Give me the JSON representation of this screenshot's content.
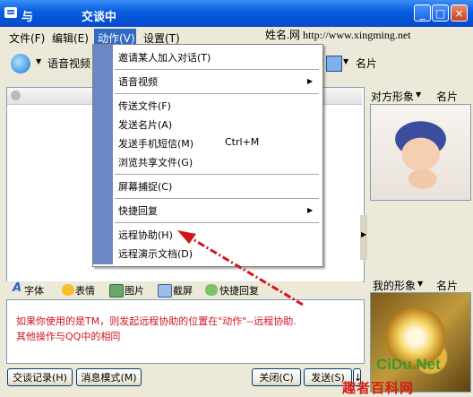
{
  "window": {
    "title_left": "与",
    "title_main": "交谈中",
    "controls": [
      "_",
      "□",
      "×"
    ]
  },
  "menubar": {
    "items": [
      "文件(F)",
      "编辑(E)",
      "动作(V)",
      "设置(T)"
    ],
    "watermark": "姓名.网 http://www.xingming.net"
  },
  "toolbar": {
    "voice_label": "语音视频",
    "card_label": "名片",
    "icon": "voice-video-icon"
  },
  "dropdown": {
    "items": [
      {
        "label": "邀请某人加入对话(T)",
        "shortcut": "",
        "submenu": false
      },
      {
        "label": "语音视频",
        "shortcut": "",
        "submenu": true
      },
      {
        "label": "传送文件(F)",
        "shortcut": "",
        "submenu": false
      },
      {
        "label": "发送名片(A)",
        "shortcut": "",
        "submenu": false
      },
      {
        "label": "发送手机短信(M)",
        "shortcut": "Ctrl+M",
        "submenu": false
      },
      {
        "label": "浏览共享文件(G)",
        "shortcut": "",
        "submenu": false
      },
      {
        "label": "屏幕捕捉(C)",
        "shortcut": "",
        "submenu": false
      },
      {
        "label": "快捷回复",
        "shortcut": "",
        "submenu": true
      },
      {
        "label": "远程协助(H)",
        "shortcut": "",
        "submenu": false
      },
      {
        "label": "远程演示文档(D)",
        "shortcut": "",
        "submenu": false
      }
    ]
  },
  "formatbar": {
    "items": [
      "字体",
      "表情",
      "图片",
      "截屏",
      "快捷回复"
    ]
  },
  "input": {
    "text_line1": "如果你使用的是TM，则发起远程协助的位置在\"动作\"--远程协助.",
    "text_line2": "其他操作与QQ中的相同"
  },
  "buttons": {
    "history": "交谈记录(H)",
    "message_mode": "消息模式(M)",
    "close": "关闭(C)",
    "send": "发送(S)"
  },
  "right_panel": {
    "peer_label": "对方形象",
    "peer_card": "名片",
    "my_label": "我的形象",
    "my_card": "名片"
  },
  "watermarks": {
    "cidu": "CiDu.Net",
    "site": "趣者百科网"
  },
  "colors": {
    "titlebar": "#0553d6",
    "menu_highlight": "#316ac5",
    "annotation": "#d2141e"
  }
}
